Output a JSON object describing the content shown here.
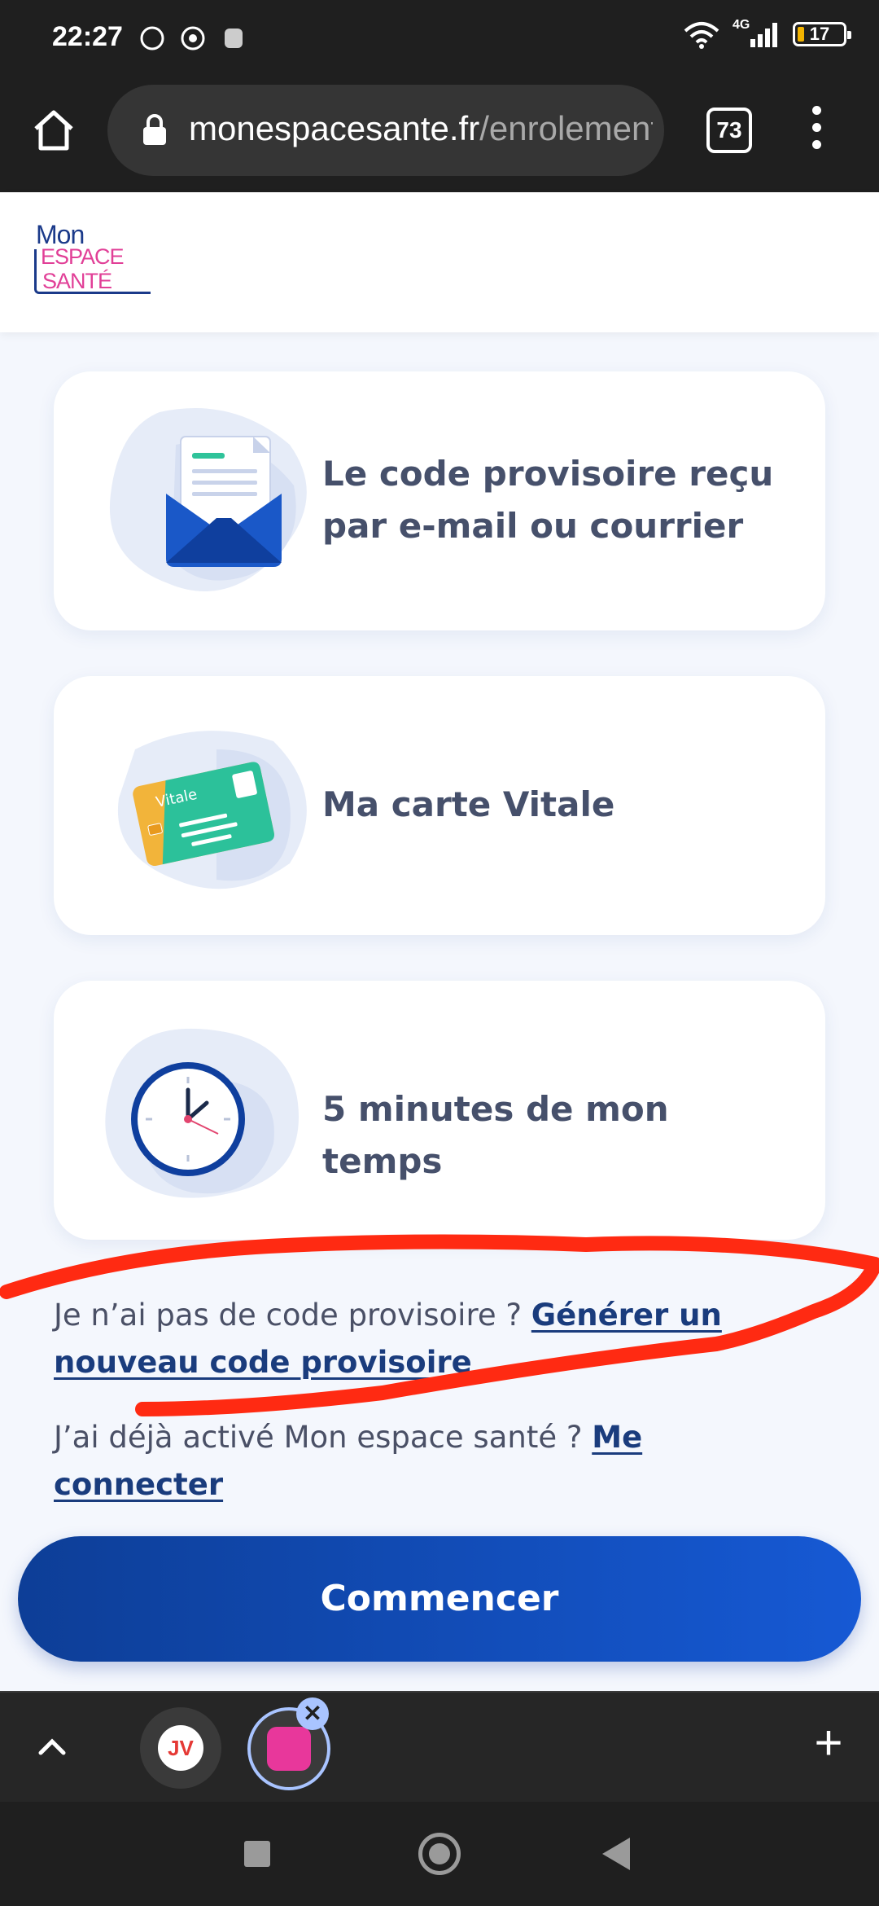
{
  "status_bar": {
    "time": "22:27",
    "network": "4G",
    "battery": "17"
  },
  "browser": {
    "url_host": "monespacesante.fr",
    "url_path": "/enrolement",
    "tab_count": "73"
  },
  "site": {
    "logo": {
      "line1": "Mon",
      "line2": "ESPACE",
      "line3": "SANTÉ"
    }
  },
  "cards": [
    {
      "text": "Le code provisoire reçu par e-mail ou courrier",
      "icon": "envelope-icon"
    },
    {
      "text": "Ma carte Vitale",
      "icon": "vitale-card-icon",
      "card_label": "Vitale"
    },
    {
      "text": "5 minutes de mon temps",
      "icon": "clock-icon"
    }
  ],
  "links": {
    "no_code_text": "Je n’ai pas de code provisoire ? ",
    "no_code_link": "Générer un nouveau code provisoire",
    "already_text": "J’ai déjà activé Mon espace santé ? ",
    "already_link": "Me connecter"
  },
  "start_button": "Commencer",
  "tab_group": {
    "tab1_label": "JV"
  },
  "colors": {
    "primary": "#1652c9",
    "card_text": "#46506b",
    "link": "#1a3c7d",
    "annotation": "#ff2a12"
  }
}
